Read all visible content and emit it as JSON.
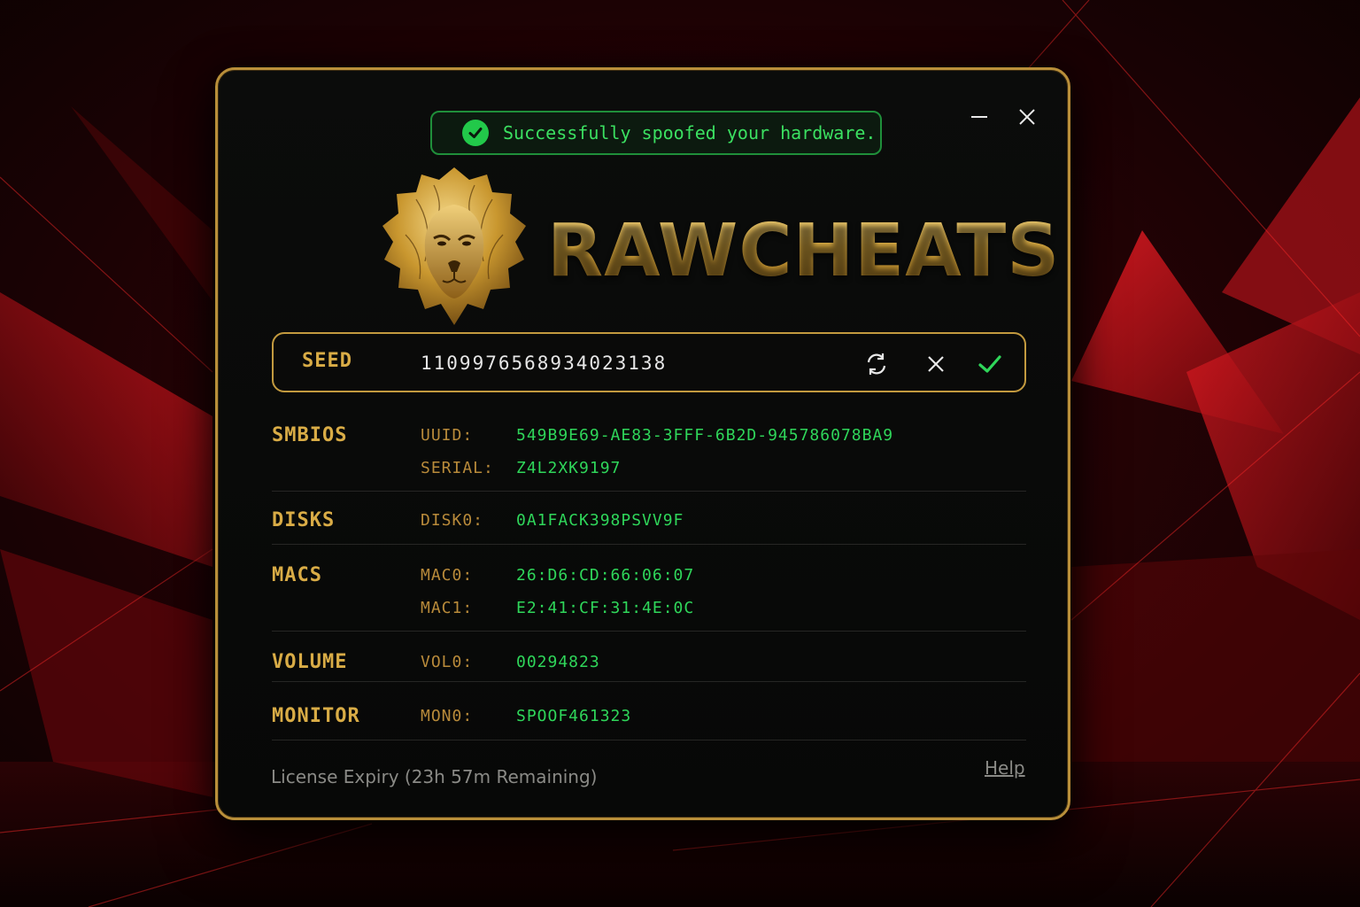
{
  "toast": {
    "message": "Successfully spoofed your hardware."
  },
  "window_controls": {
    "minimize_icon": "minimize-icon",
    "close_icon": "close-icon"
  },
  "brand": {
    "name": "RAWCHEATS",
    "logo": "lion-logo"
  },
  "seed": {
    "label": "SEED",
    "value": "1109976568934023138",
    "actions": [
      "refresh-icon",
      "clear-icon",
      "check-icon"
    ]
  },
  "hardware": {
    "smbios": {
      "title": "SMBIOS",
      "rows": [
        {
          "key": "UUID:",
          "value": "549B9E69-AE83-3FFF-6B2D-945786078BA9"
        },
        {
          "key": "SERIAL:",
          "value": "Z4L2XK9197"
        }
      ]
    },
    "disks": {
      "title": "DISKS",
      "rows": [
        {
          "key": "DISK0:",
          "value": "0A1FACK398PSVV9F"
        }
      ]
    },
    "macs": {
      "title": "MACS",
      "rows": [
        {
          "key": "MAC0:",
          "value": "26:D6:CD:66:06:07"
        },
        {
          "key": "MAC1:",
          "value": "E2:41:CF:31:4E:0C"
        }
      ]
    },
    "volume": {
      "title": "VOLUME",
      "rows": [
        {
          "key": "VOL0:",
          "value": "00294823"
        }
      ]
    },
    "monitor": {
      "title": "MONITOR",
      "rows": [
        {
          "key": "MON0:",
          "value": "SPOOF461323"
        }
      ]
    }
  },
  "footer": {
    "license": "License Expiry (23h 57m Remaining)",
    "help": "Help"
  },
  "colors": {
    "accent_gold": "#d9ac46",
    "value_green": "#2fd65a",
    "background_red": "#c0141c"
  }
}
